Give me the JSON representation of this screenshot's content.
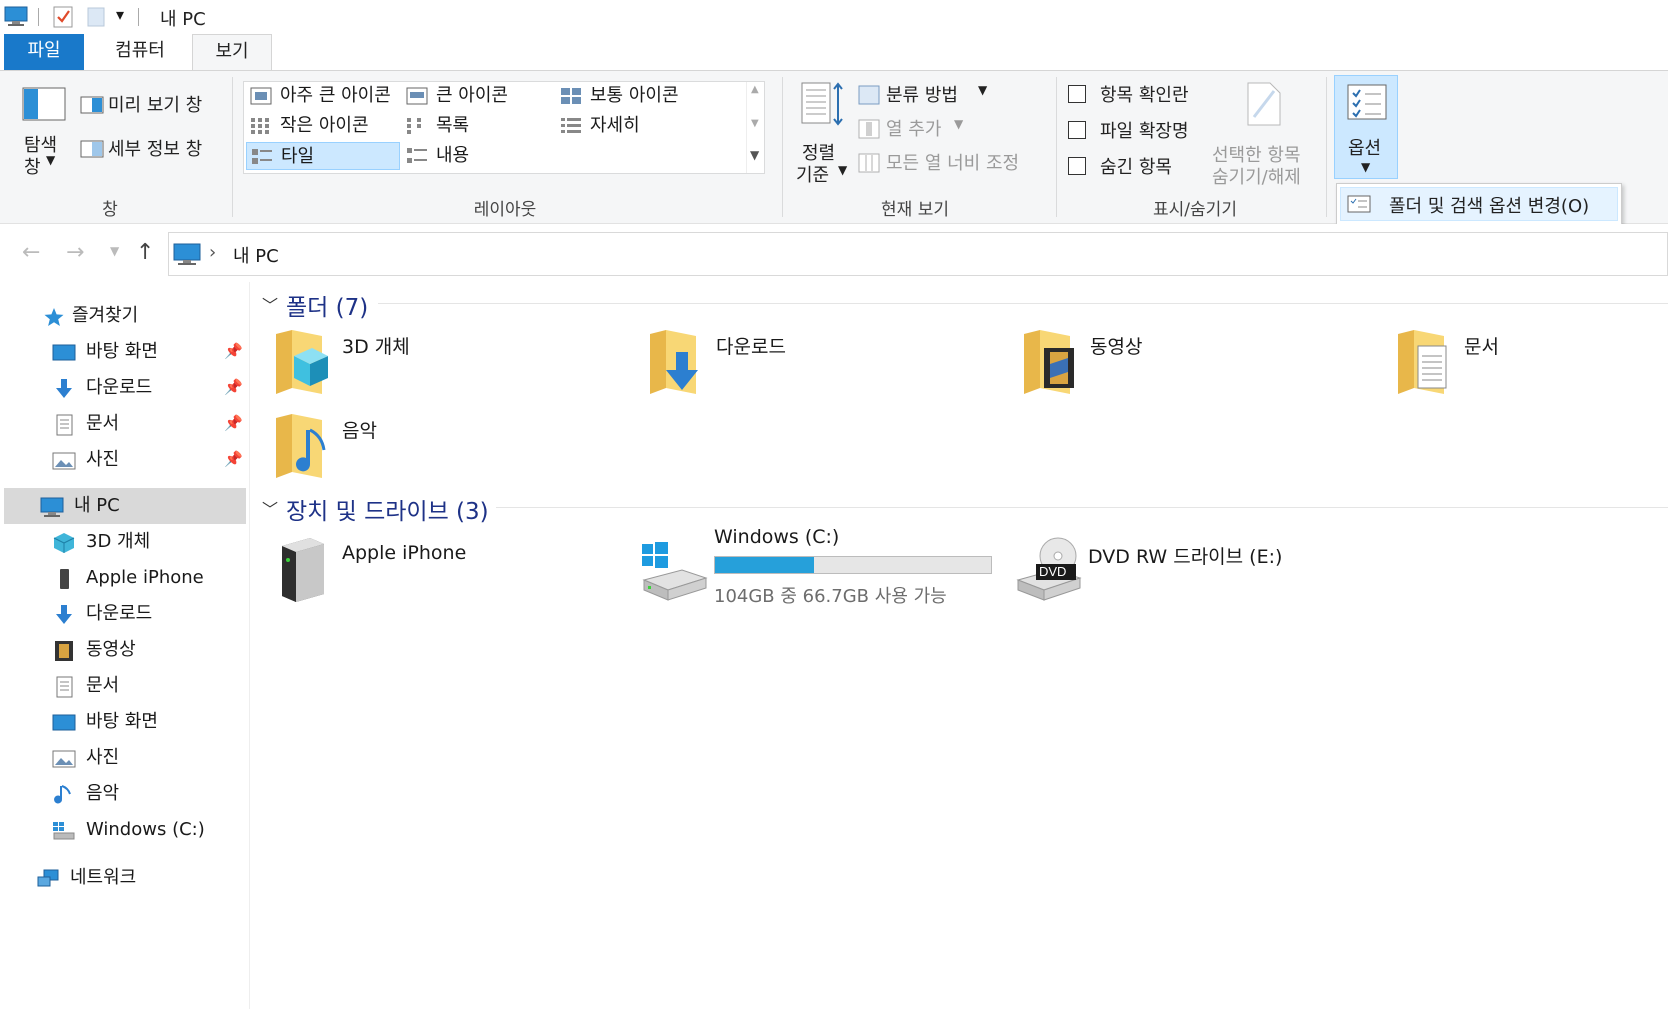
{
  "title_bar": {
    "title": "내 PC",
    "qa_dropdown": "▾"
  },
  "ribbon_tabs": [
    "파일",
    "컴퓨터",
    "보기"
  ],
  "ribbon": {
    "panes": {
      "nav_pane_line1": "탐색",
      "nav_pane_line2": "창",
      "preview_pane": "미리 보기 창",
      "details_pane": "세부 정보 창",
      "group_label": "창"
    },
    "layout": {
      "items": [
        "아주 큰 아이콘",
        "큰 아이콘",
        "보통 아이콘",
        "작은 아이콘",
        "목록",
        "자세히",
        "타일",
        "내용"
      ],
      "selected": "타일",
      "group_label": "레이아웃"
    },
    "current_view": {
      "sort_line1": "정렬",
      "sort_line2": "기준",
      "group_by": "분류 방법",
      "add_columns": "열 추가",
      "size_all_columns": "모든 열 너비 조정",
      "group_label": "현재 보기"
    },
    "show_hide": {
      "item_checkboxes": "항목 확인란",
      "file_extensions": "파일 확장명",
      "hidden_items": "숨긴 항목",
      "hide_selected_line1": "선택한 항목",
      "hide_selected_line2": "숨기기/해제",
      "group_label": "표시/숨기기"
    },
    "options": {
      "label": "옵션",
      "menu_item": "폴더 및 검색 옵션 변경(O)"
    }
  },
  "address_bar": {
    "separator": "›",
    "location": "내 PC"
  },
  "nav_pane": {
    "quick_access": "즐겨찾기",
    "quick_items": [
      "바탕 화면",
      "다운로드",
      "문서",
      "사진"
    ],
    "this_pc": "내 PC",
    "pc_items": [
      "3D 개체",
      "Apple iPhone",
      "다운로드",
      "동영상",
      "문서",
      "바탕 화면",
      "사진",
      "음악",
      "Windows (C:)"
    ],
    "network": "네트워크"
  },
  "content": {
    "folders_header": "폴더 (7)",
    "folders": [
      "3D 개체",
      "다운로드",
      "동영상",
      "문서",
      "음악"
    ],
    "devices_header": "장치 및 드라이브 (3)",
    "devices": {
      "iphone": "Apple iPhone",
      "windows_name": "Windows (C:)",
      "windows_space": "104GB 중 66.7GB 사용 가능",
      "windows_used_fraction": 0.36,
      "dvd": "DVD RW 드라이브 (E:)",
      "dvd_badge": "DVD"
    }
  },
  "colors": {
    "accent": "#1979ca",
    "section_header": "#1e3287",
    "drive_fill": "#26a0da",
    "selection": "#cce8ff"
  }
}
